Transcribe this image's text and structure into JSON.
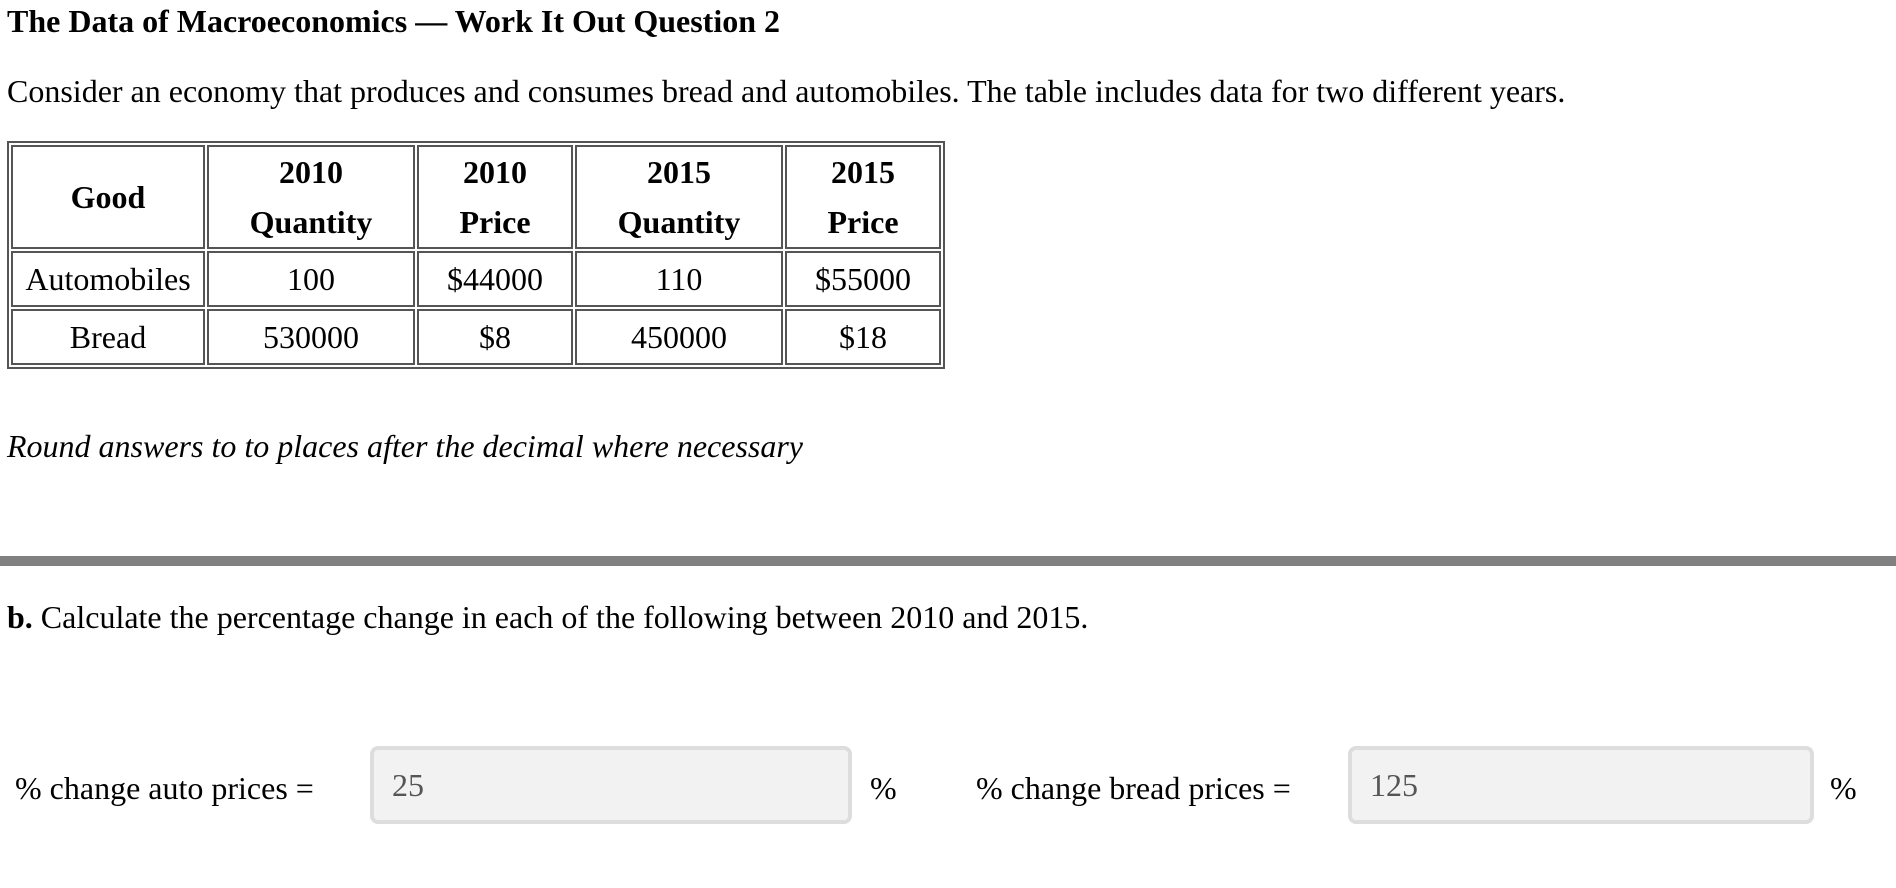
{
  "header": {
    "title": "The Data of Macroeconomics — Work It Out Question 2"
  },
  "intro": "Consider an economy that produces and consumes bread and automobiles. The table includes data for two different years.",
  "table": {
    "headers": [
      {
        "line1": "Good",
        "line2": ""
      },
      {
        "line1": "2010",
        "line2": "Quantity"
      },
      {
        "line1": "2010",
        "line2": "Price"
      },
      {
        "line1": "2015",
        "line2": "Quantity"
      },
      {
        "line1": "2015",
        "line2": "Price"
      }
    ],
    "rows": [
      [
        "Automobiles",
        "100",
        "$44000",
        "110",
        "$55000"
      ],
      [
        "Bread",
        "530000",
        "$8",
        "450000",
        "$18"
      ]
    ]
  },
  "note": "Round answers to to places after the decimal where necessary",
  "part_b": {
    "label": "b.",
    "text": " Calculate the percentage change in each of the following between 2010 and 2015."
  },
  "answers": [
    {
      "label": "% change auto prices =",
      "value": "25",
      "unit": "%"
    },
    {
      "label": "% change bread prices =",
      "value": "125",
      "unit": "%"
    }
  ]
}
